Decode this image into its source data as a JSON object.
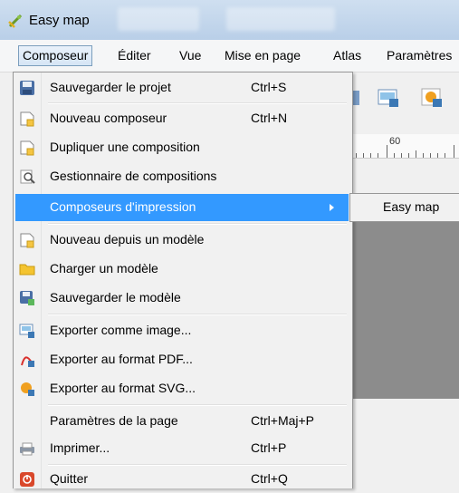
{
  "window": {
    "title": "Easy map",
    "icon": "qgis-icon"
  },
  "menubar": {
    "items": [
      "Composeur",
      "Éditer",
      "Vue",
      "Mise en page",
      "Atlas",
      "Paramètres"
    ],
    "active": "Composeur"
  },
  "ruler": {
    "label": "60"
  },
  "menu": {
    "items": [
      {
        "label": "Sauvegarder le projet",
        "shortcut": "Ctrl+S",
        "icon": "save-icon"
      },
      {
        "label": "Nouveau composeur",
        "shortcut": "Ctrl+N",
        "icon": "new-composer-icon"
      },
      {
        "label": "Dupliquer une composition",
        "shortcut": "",
        "icon": "duplicate-icon"
      },
      {
        "label": "Gestionnaire de compositions",
        "shortcut": "",
        "icon": "manager-icon"
      },
      {
        "label": "Composeurs d'impression",
        "shortcut": "",
        "icon": "",
        "submenu": true
      },
      {
        "label": "Nouveau depuis un modèle",
        "shortcut": "",
        "icon": "new-from-template-icon"
      },
      {
        "label": "Charger un modèle",
        "shortcut": "",
        "icon": "folder-icon"
      },
      {
        "label": "Sauvegarder le modèle",
        "shortcut": "",
        "icon": "save-template-icon"
      },
      {
        "label": "Exporter comme image...",
        "shortcut": "",
        "icon": "export-image-icon"
      },
      {
        "label": "Exporter au format PDF...",
        "shortcut": "",
        "icon": "export-pdf-icon"
      },
      {
        "label": "Exporter au format SVG...",
        "shortcut": "",
        "icon": "export-svg-icon"
      },
      {
        "label": "Paramètres de la page",
        "shortcut": "Ctrl+Maj+P",
        "icon": ""
      },
      {
        "label": "Imprimer...",
        "shortcut": "Ctrl+P",
        "icon": "printer-icon"
      },
      {
        "label": "Quitter",
        "shortcut": "Ctrl+Q",
        "icon": "quit-icon"
      }
    ]
  },
  "submenu": {
    "items": [
      "Easy map"
    ]
  },
  "colors": {
    "highlight": "#3399ff",
    "menu_bg": "#f1f1f1"
  }
}
